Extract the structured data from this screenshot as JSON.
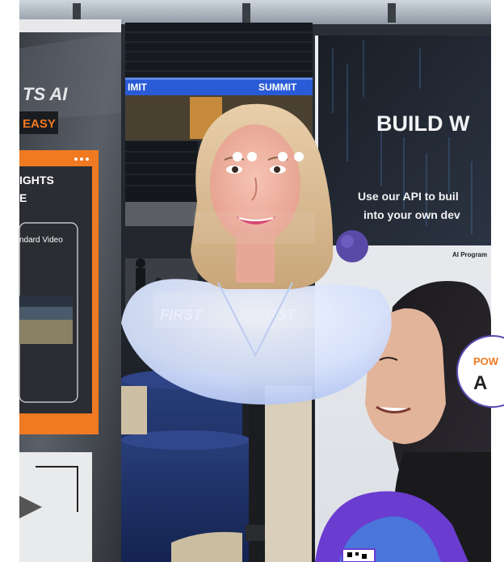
{
  "scene": {
    "type": "photo",
    "subject": "holographic-fan-display",
    "colors": {
      "stadium_seats": "#1b1f26",
      "blue_banner": "#2a5bd6",
      "tablecloth": "#1d2f63",
      "orange_accent": "#f07a22",
      "dark_banner": "#16191f",
      "hologram_glow": "#d9e6ff",
      "purple_accent": "#6a3ccf"
    }
  },
  "stadium_banner": {
    "left": "IMIT",
    "right": "SUMMIT"
  },
  "left_banner": {
    "title": "TS AI",
    "tag": "EASY",
    "panel_title": "IGHTS",
    "panel_sub": "E",
    "video_label": "ndard Video"
  },
  "right_banner": {
    "headline": "BUILD W",
    "line1": "Use our API to buil",
    "line2": "into your own dev",
    "program": "AI Program",
    "badge_top": "POW",
    "badge_letter": "A"
  },
  "hologram": {
    "overlay_left": "FIRST",
    "overlay_right": "RST"
  }
}
